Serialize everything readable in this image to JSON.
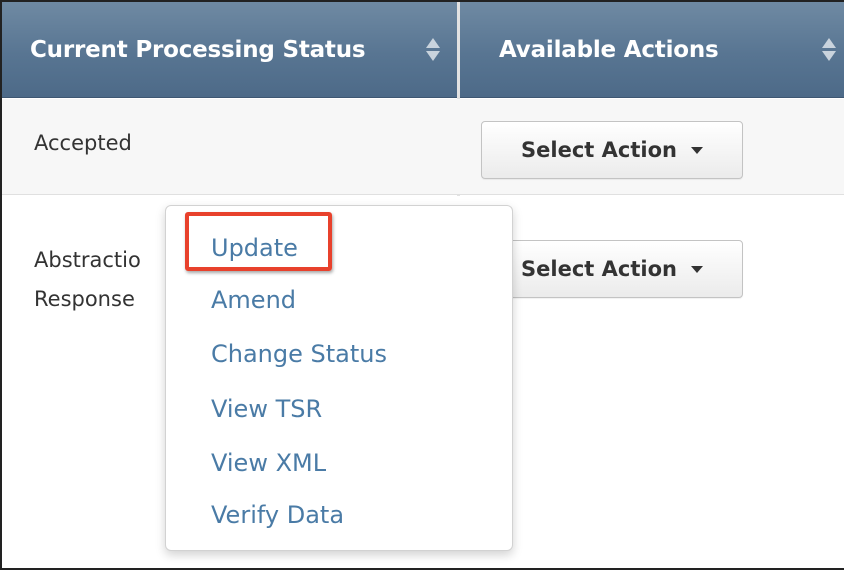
{
  "table": {
    "headers": {
      "status": "Current Processing Status",
      "actions": "Available Actions"
    },
    "rows": [
      {
        "status": "Accepted",
        "action_button": "Select Action"
      },
      {
        "status_line1": "Abstractio",
        "status_line2": "Response",
        "action_button": "Select Action"
      }
    ]
  },
  "dropdown_menu": {
    "items": [
      "Update",
      "Amend",
      "Change Status",
      "View TSR",
      "View XML",
      "Verify Data"
    ],
    "highlighted_item": "Update"
  },
  "colors": {
    "header_bg": "#587592",
    "link": "#4a7ba6",
    "highlight_border": "#e8412c"
  },
  "icons": [
    "sort-icon",
    "caret-down-icon"
  ]
}
